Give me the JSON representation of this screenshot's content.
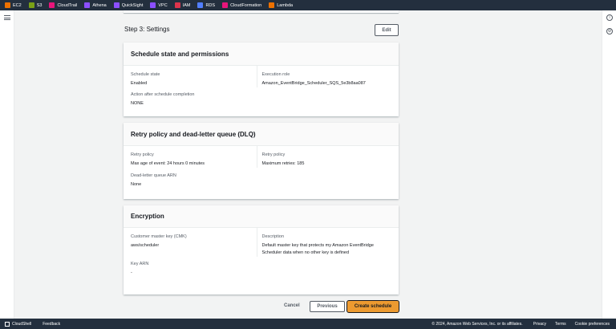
{
  "topbar": {
    "services": [
      {
        "label": "EC2",
        "color": "#ed7100"
      },
      {
        "label": "S3",
        "color": "#7aa116"
      },
      {
        "label": "CloudTrail",
        "color": "#e7157b"
      },
      {
        "label": "Athena",
        "color": "#8c4fff"
      },
      {
        "label": "QuickSight",
        "color": "#8c4fff"
      },
      {
        "label": "VPC",
        "color": "#8c4fff"
      },
      {
        "label": "IAM",
        "color": "#dd344c"
      },
      {
        "label": "RDS",
        "color": "#527fff"
      },
      {
        "label": "CloudFormation",
        "color": "#e7157b"
      },
      {
        "label": "Lambda",
        "color": "#ed7100"
      }
    ]
  },
  "step": {
    "title": "Step 3: Settings",
    "edit": "Edit"
  },
  "cards": [
    {
      "title": "Schedule state and permissions",
      "fields": [
        {
          "label": "Schedule state",
          "value": "Enabled"
        },
        {
          "label": "Execution role",
          "value": "Amazon_EventBridge_Scheduler_SQS_5e3b8aa087"
        },
        {
          "label": "Action after schedule completion",
          "value": "NONE"
        }
      ]
    },
    {
      "title": "Retry policy and dead-letter queue (DLQ)",
      "fields": [
        {
          "label": "Retry policy",
          "value": "Max age of event: 24 hours 0 minutes"
        },
        {
          "label": "Retry policy",
          "value": "Maximum retries: 185"
        },
        {
          "label": "Dead-letter queue ARN",
          "value": "None"
        }
      ]
    },
    {
      "title": "Encryption",
      "fields": [
        {
          "label": "Customer master key (CMK)",
          "value": "aws/scheduler"
        },
        {
          "label": "Description",
          "value": "Default master key that protects my Amazon EventBridge Scheduler data when no other key is defined"
        },
        {
          "label": "Key ARN",
          "value": "-"
        }
      ]
    }
  ],
  "actions": {
    "cancel": "Cancel",
    "previous": "Previous",
    "create": "Create schedule"
  },
  "footer": {
    "cloudshell": "CloudShell",
    "feedback": "Feedback",
    "copyright": "© 2024, Amazon Web Services, Inc. or its affiliates.",
    "privacy": "Privacy",
    "terms": "Terms",
    "cookies": "Cookie preferences"
  }
}
